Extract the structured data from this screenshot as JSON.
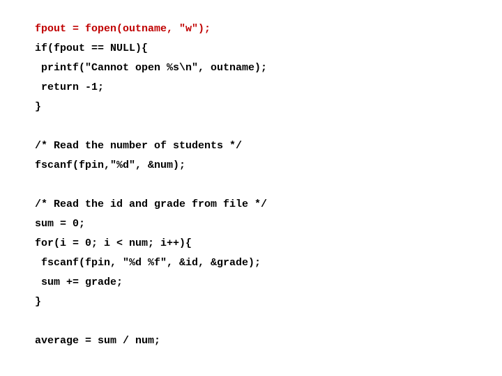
{
  "code": {
    "lines": [
      {
        "text": "fpout = fopen(outname, \"w\");",
        "highlight": true
      },
      {
        "text": "if(fpout == NULL){",
        "highlight": false
      },
      {
        "text": " printf(\"Cannot open %s\\n\", outname);",
        "highlight": false
      },
      {
        "text": " return -1;",
        "highlight": false
      },
      {
        "text": "}",
        "highlight": false
      },
      {
        "text": "",
        "highlight": false
      },
      {
        "text": "/* Read the number of students */",
        "highlight": false
      },
      {
        "text": "fscanf(fpin,\"%d\", &num);",
        "highlight": false
      },
      {
        "text": "",
        "highlight": false
      },
      {
        "text": "/* Read the id and grade from file */",
        "highlight": false
      },
      {
        "text": "sum = 0;",
        "highlight": false
      },
      {
        "text": "for(i = 0; i < num; i++){",
        "highlight": false
      },
      {
        "text": " fscanf(fpin, \"%d %f\", &id, &grade);",
        "highlight": false
      },
      {
        "text": " sum += grade;",
        "highlight": false
      },
      {
        "text": "}",
        "highlight": false
      },
      {
        "text": "",
        "highlight": false
      },
      {
        "text": "average = sum / num;",
        "highlight": false
      }
    ]
  }
}
